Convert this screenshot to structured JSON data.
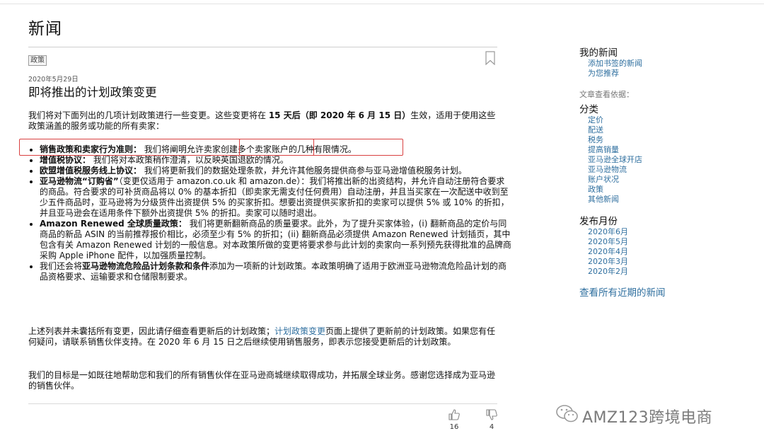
{
  "page_title": "新闻",
  "article": {
    "tag": "政策",
    "date": "2020年5月29日",
    "title": "即将推出的计划政策变更",
    "intro_1": "我们将对下面列出的几项计划政策进行一些变更。这些变更将在 ",
    "intro_bold": "15 天后（即 2020 年 6 月 15 日）",
    "intro_2": "生效，适用于使用这些政策涵盖的服务或功能的所有卖家：",
    "bullets": [
      {
        "bold": "销售政策和卖家行为准则：",
        "text": "我们将阐明允许卖家创建多个卖家账户的几种有限情况。"
      },
      {
        "bold": "增值税协议：",
        "text": "我们将对本政策稍作澄清，以反映英国退欧的情况。"
      },
      {
        "bold": "欧盟增值税服务线上协议：",
        "text": "我们将更新我们的数据处理条款，并允许其他服务提供商参与亚马逊增值税服务计划。"
      },
      {
        "bold": "亚马逊物流“订购省”",
        "text": "（变更仅适用于 amazon.co.uk 和 amazon.de）：我们将推出新的出资结构，并允许自动注册符合要求的商品。符合要求的可补货商品将以 0% 的基本折扣（即卖家无需支付任何费用）自动注册，并且当买家在一次配送中收到至少五件商品时，亚马逊将为分级货件出资提供 5% 的买家折扣。想要出资提供买家折扣的卖家可以提供 5% 或 10% 的折扣，并且亚马逊会在适用条件下额外出资提供 5% 的折扣。卖家可以随时退出。"
      },
      {
        "bold": "Amazon Renewed 全球质量政策：",
        "text": "我们将更新翻新商品的质量要求。此外，为了提升买家体验，(i) 翻新商品的定价与同商品的新品 ASIN 的当前推荐报价相比，必须至少有 5% 的折扣；(ii) 翻新商品必须提供 Amazon Renewed 计划插页，其中包含有关 Amazon Renewed 计划的一般信息。对本政策所做的变更将要求参与此计划的卖家向一系列预先获得批准的品牌商采购 Apple iPhone 配件，以加强质量控制。"
      },
      {
        "pre": "我们还会将",
        "bold": "亚马逊物流危险品计划条款和条件",
        "text": "添加为一项新的计划政策。本政策明确了适用于欧洲亚马逊物流危险品计划的商品资格要求、运输要求和仓储限制要求。"
      }
    ],
    "para2_1": "上述列表并未囊括所有变更，因此请仔细查看更新后的计划政策；",
    "para2_link": "计划政策变更",
    "para2_2": "页面上提供了更新前的计划政策。如果您有任何疑问，请联系销售伙伴支持。在 2020 年 6 月 15 日之后继续使用销售服务，即表示您接受更新后的计划政策。",
    "para3": "我们的目标是一如既往地帮助您和我们的所有销售伙伴在亚马逊商城继续取得成功，并拓展全球业务。感谢您选择成为亚马逊的销售伙伴。",
    "likes": "16",
    "dislikes": "4"
  },
  "sidebar": {
    "my_news": "我的新闻",
    "my_news_links": [
      "添加书签的新闻",
      "为您推荐"
    ],
    "view_by": "文章查看依据：",
    "category_heading": "分类",
    "categories": [
      "定价",
      "配送",
      "税务",
      "提高销量",
      "亚马逊全球开店",
      "亚马逊物流",
      "账户状况",
      "政策",
      "其他新闻"
    ],
    "month_heading": "发布月份",
    "months": [
      "2020年6月",
      "2020年5月",
      "2020年4月",
      "2020年3月",
      "2020年2月"
    ],
    "view_all": "查看所有近期的新闻"
  },
  "watermark": "AMZ123跨境电商",
  "colors": {
    "link": "#2f6f9f",
    "highlight": "#d94040"
  }
}
